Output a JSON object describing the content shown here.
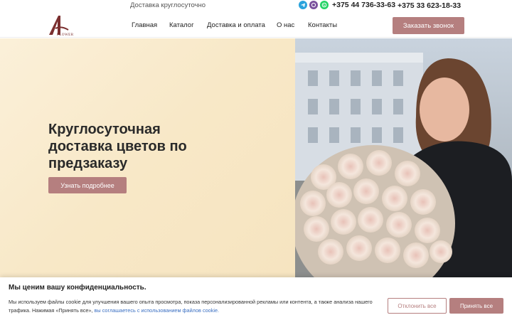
{
  "header": {
    "tagline": "Доставка круглосуточно",
    "phone1": "+375 44 736-33-63",
    "phone2": "+375 33 623-18-33",
    "logo_text": "FLOWER",
    "call_button": "Заказать звонок",
    "messengers": [
      "telegram-icon",
      "viber-icon",
      "whatsapp-icon"
    ]
  },
  "nav": {
    "items": [
      "Главная",
      "Каталог",
      "Доставка и оплата",
      "О нас",
      "Контакты"
    ]
  },
  "hero": {
    "title_lines": [
      "Круглосуточная",
      "доставка цветов по",
      "предзаказу"
    ],
    "button": "Узнать подробнее"
  },
  "cookie": {
    "title": "Мы ценим вашу конфиденциальность.",
    "text": "Мы используем файлы cookie для улучшения вашего опыта просмотра, показа персонализированной рекламы или контента, а также анализа нашего трафика. Нажимая «Принять все», ",
    "link": "вы соглашаетесь с использованием файлов cookie.",
    "reject": "Отклонить все",
    "accept": "Принять все"
  },
  "colors": {
    "accent": "#b57f7f",
    "hero_bg": "#f8e8c7",
    "logo": "#7a2f2f"
  }
}
